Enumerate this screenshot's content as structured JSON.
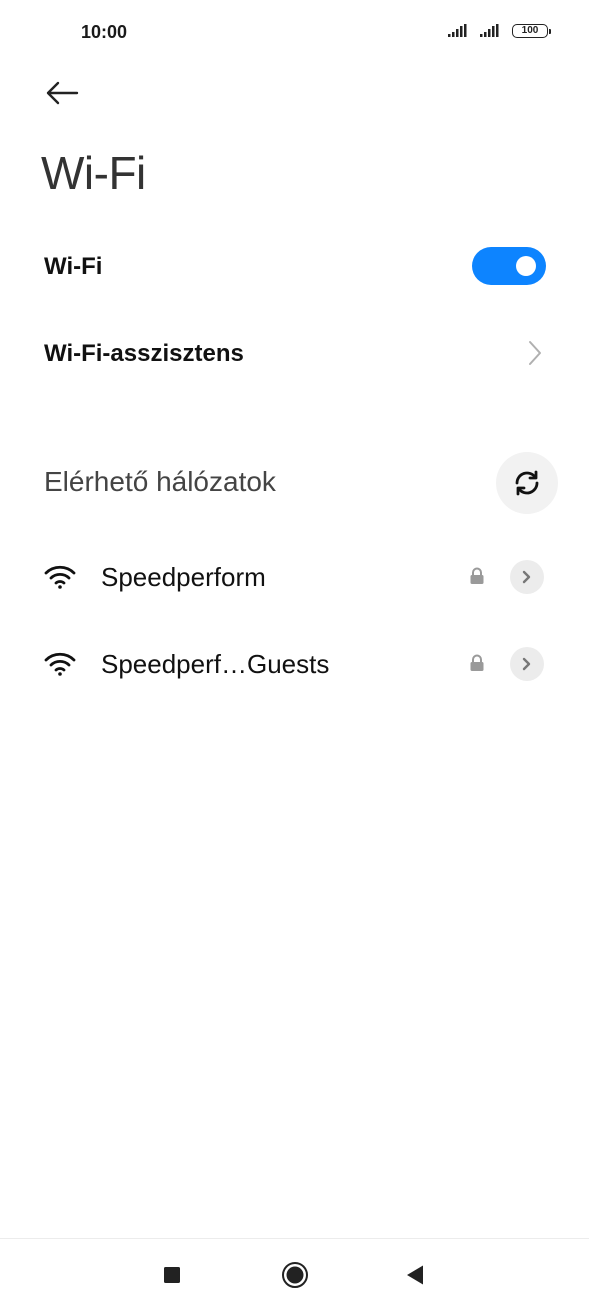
{
  "status_bar": {
    "time": "10:00",
    "battery": "100",
    "icons": [
      "signal-icon",
      "signal-icon",
      "battery-icon"
    ]
  },
  "header": {
    "back_icon": "arrow-left-icon",
    "title": "Wi-Fi"
  },
  "settings": {
    "wifi_label": "Wi-Fi",
    "wifi_enabled": true,
    "assistant_label": "Wi-Fi-asszisztens"
  },
  "networks": {
    "section_title": "Elérhető hálózatok",
    "refresh_icon": "refresh-icon",
    "items": [
      {
        "name": "Speedperform",
        "secured": true
      },
      {
        "name": "Speedperf…Guests",
        "secured": true
      }
    ]
  },
  "nav_bar": {
    "icons": [
      "recents-square-icon",
      "home-circle-icon",
      "back-triangle-icon"
    ]
  },
  "colors": {
    "accent": "#0d84ff",
    "background": "#ffffff"
  }
}
